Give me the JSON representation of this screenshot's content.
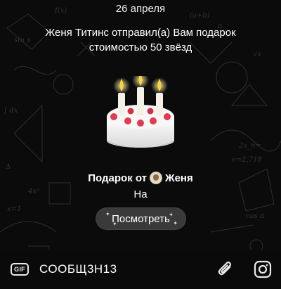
{
  "chat": {
    "date": "26 апреля",
    "service_message": {
      "line1": "Женя Титинс отправил(а) Вам подарок",
      "line2": "стоимостью 50 звёзд"
    },
    "gift": {
      "emoji": "birthday-cake-icon",
      "from_prefix": "Подарок от",
      "sender_name": "Женя",
      "subtitle": "На",
      "view_button": "Посмотреть"
    }
  },
  "composer": {
    "gif_label": "GIF",
    "input_value": "СООБЩ3Н13",
    "attach_icon": "paperclip-icon",
    "camera_icon": "instagram-camera-icon"
  },
  "colors": {
    "background": "#0b0b0b",
    "button_bg": "#3a3a3a",
    "text": "#ffffff"
  }
}
